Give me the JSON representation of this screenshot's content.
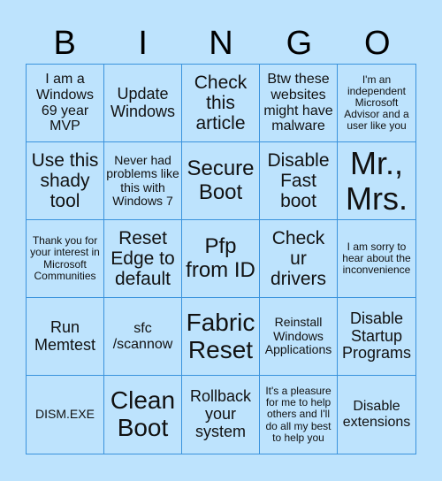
{
  "header": {
    "letters": [
      "B",
      "I",
      "N",
      "G",
      "O"
    ]
  },
  "board": {
    "cells": [
      "I am a Windows 69 year MVP",
      "Update Windows",
      "Check this article",
      "Btw these websites might have malware",
      "I'm an independent Microsoft Advisor and a user like you",
      "Use this shady tool",
      "Never had problems like this with Windows 7",
      "Secure Boot",
      "Disable Fast boot",
      "Mr., Mrs.",
      "Thank you for your interest in Microsoft Communities",
      "Reset Edge to default",
      "Pfp from ID",
      "Check ur drivers",
      "I am sorry to hear about the inconvenience",
      "Run Memtest",
      "sfc /scannow",
      "Fabric Reset",
      "Reinstall Windows Applications",
      "Disable Startup Programs",
      "DISM.EXE",
      "Clean Boot",
      "Rollback your system",
      "It's a pleasure for me to help others and I'll do all my best to help you",
      "Disable extensions"
    ]
  },
  "colors": {
    "background": "#bde3fd",
    "border": "#3a93dd",
    "text": "#111111"
  }
}
